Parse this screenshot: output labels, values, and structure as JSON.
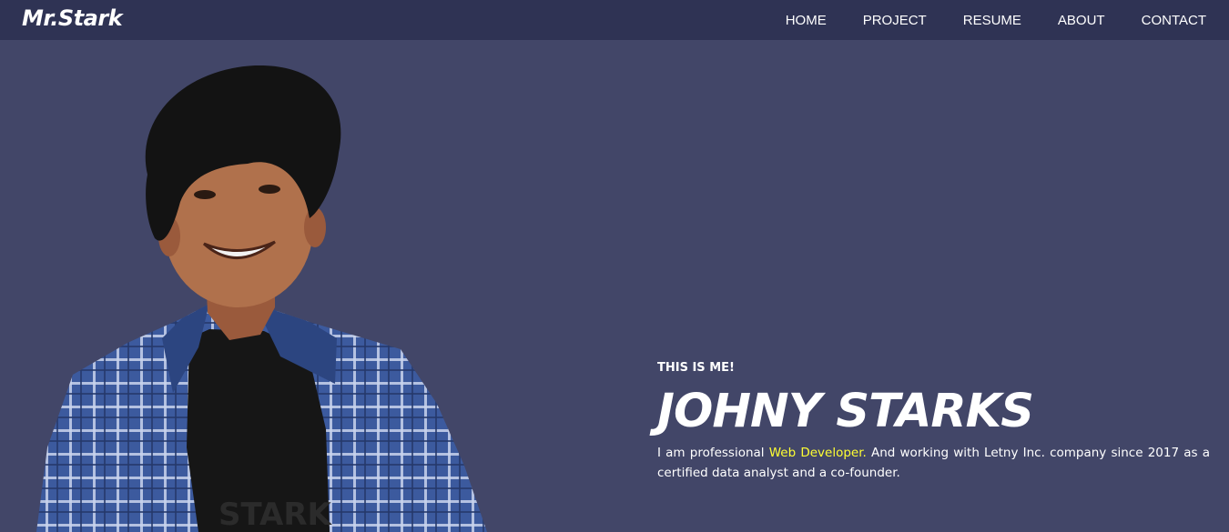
{
  "brand": {
    "name": "Mr.Stark"
  },
  "nav": {
    "items": [
      {
        "label": "HOME"
      },
      {
        "label": "PROJECT"
      },
      {
        "label": "RESUME"
      },
      {
        "label": "ABOUT"
      },
      {
        "label": "CONTACT"
      }
    ]
  },
  "hero": {
    "eyebrow": "THIS IS ME!",
    "name": "JOHNY STARKS",
    "intro_prefix": "I am professional ",
    "intro_highlight": "Web Developer.",
    "intro_suffix": " And working with Letny Inc. company since 2017 as a certified data analyst and a co-founder."
  },
  "photo": {
    "subject": "portrait-photo",
    "shirt_print": "STARK"
  },
  "colors": {
    "page_background": "#424668",
    "navbar_background": "#2f3354",
    "text": "#ffffff",
    "highlight": "#ffff33",
    "shirt_blue": "#3c5a9e",
    "shirt_dark": "#161616"
  }
}
